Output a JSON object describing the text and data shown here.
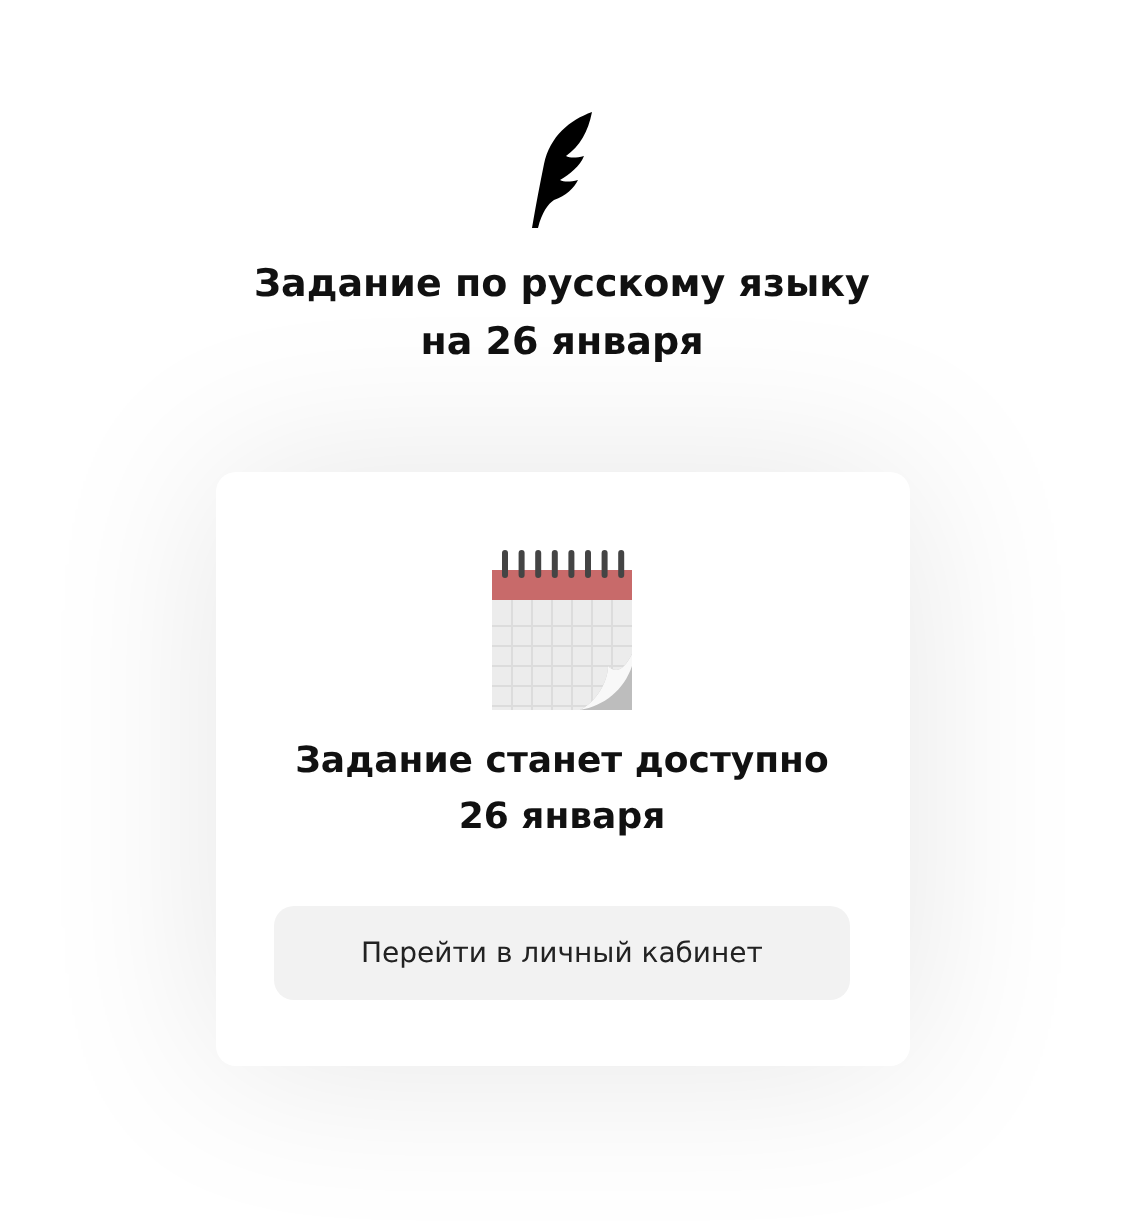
{
  "header": {
    "title_lines": [
      "Задание по русскому языку",
      "на 26 января"
    ]
  },
  "card": {
    "message_lines": [
      "Задание станет доступно",
      "26 января"
    ],
    "button": "Перейти в личный кабинет"
  }
}
